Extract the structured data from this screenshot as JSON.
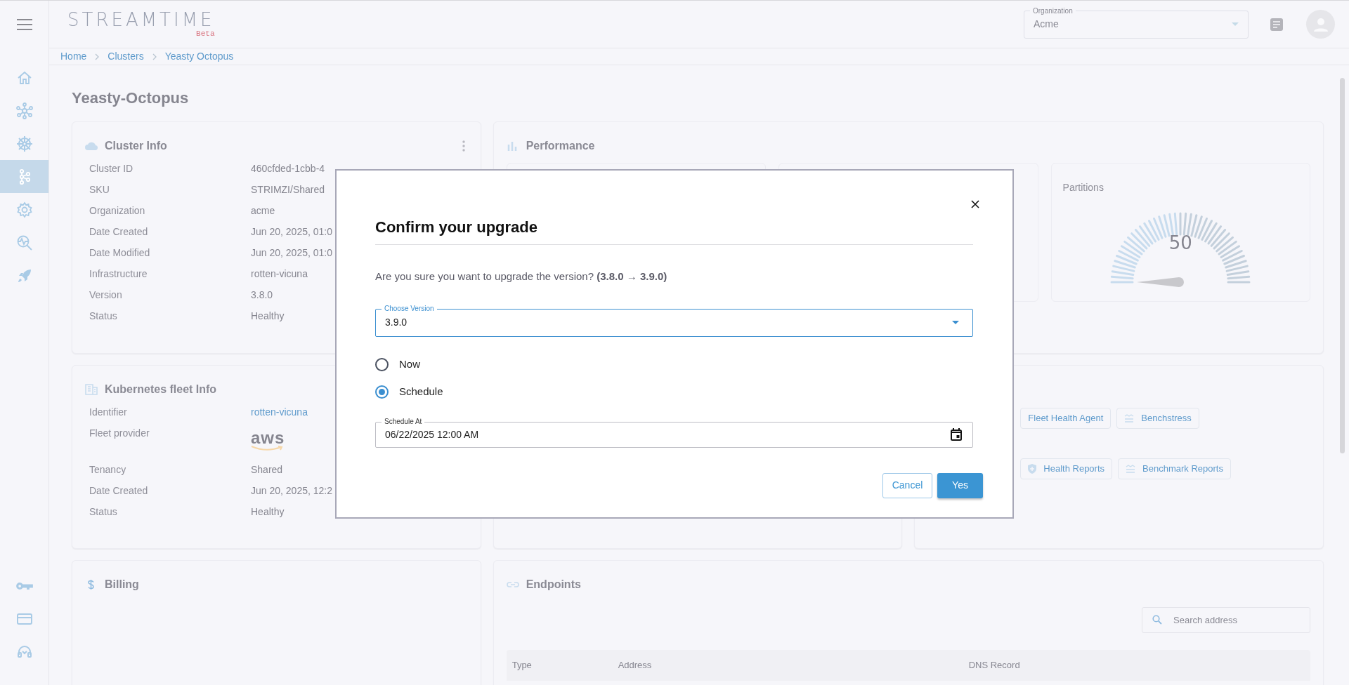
{
  "header": {
    "logo": "STREAMTIME",
    "logo_tag": "Beta",
    "organization": {
      "label": "Organization",
      "value": "Acme"
    }
  },
  "sidebar": {
    "top_items": [
      {
        "kind": "home",
        "selected": false
      },
      {
        "kind": "network",
        "selected": false
      },
      {
        "kind": "wheel",
        "selected": false
      },
      {
        "kind": "nodes",
        "selected": true
      },
      {
        "kind": "gear",
        "selected": false
      },
      {
        "kind": "monitor",
        "selected": false
      },
      {
        "kind": "rocket",
        "selected": false
      }
    ],
    "bottom_items": [
      {
        "kind": "key",
        "selected": false
      },
      {
        "kind": "card",
        "selected": false
      },
      {
        "kind": "headset",
        "selected": false
      }
    ]
  },
  "breadcrumbs": [
    "Home",
    "Clusters",
    "Yeasty Octopus"
  ],
  "page_title": "Yeasty-Octopus",
  "cluster_info": {
    "title": "Cluster Info",
    "rows": [
      {
        "label": "Cluster ID",
        "value": "460cfded-1cbb-4"
      },
      {
        "label": "SKU",
        "value": "STRIMZI/Shared"
      },
      {
        "label": "Organization",
        "value": "acme"
      },
      {
        "label": "Date Created",
        "value": "Jun 20, 2025, 01:0"
      },
      {
        "label": "Date Modified",
        "value": "Jun 20, 2025, 01:0"
      },
      {
        "label": "Infrastructure",
        "value": "rotten-vicuna"
      },
      {
        "label": "Version",
        "value": "3.8.0"
      },
      {
        "label": "Status",
        "value": "Healthy"
      }
    ]
  },
  "performance": {
    "title": "Performance",
    "partitions": {
      "label": "Partitions",
      "reading": "50"
    }
  },
  "fleet_info": {
    "title": "Kubernetes fleet Info",
    "rows": [
      {
        "label": "Identifier",
        "value": "rotten-vicuna",
        "kind": "link"
      },
      {
        "label": "Fleet provider",
        "value": "aws",
        "kind": "logo"
      },
      {
        "label": "Tenancy",
        "value": "Shared",
        "kind": "text"
      },
      {
        "label": "Date Created",
        "value": "Jun 20, 2025, 12:2",
        "kind": "text"
      },
      {
        "label": "Status",
        "value": "Healthy",
        "kind": "text"
      }
    ]
  },
  "tools": {
    "rows": [
      [
        {
          "label": "Fleet Health Agent",
          "kind": "plain"
        },
        {
          "label": "Benchstress",
          "kind": "lines"
        }
      ],
      [
        {
          "label": "Health Reports",
          "kind": "shield"
        },
        {
          "label": "Benchmark Reports",
          "kind": "lines"
        }
      ]
    ]
  },
  "billing": {
    "title": "Billing"
  },
  "endpoints": {
    "title": "Endpoints",
    "search_placeholder": "Search address",
    "columns": [
      "Type",
      "Address",
      "DNS Record"
    ]
  },
  "dialog": {
    "title": "Confirm your upgrade",
    "message": "Are you sure you want to upgrade the version? **(3.8.0 → 3.9.0)**",
    "version_select": {
      "label": "Choose Version",
      "value": "3.9.0"
    },
    "options": [
      {
        "label": "Now",
        "selected": false
      },
      {
        "label": "Schedule",
        "selected": true
      }
    ],
    "schedule_field": {
      "label": "Schedule At",
      "value": "06/22/2025 12:00 AM"
    },
    "buttons": [
      {
        "label": "Cancel",
        "kind": "secondary"
      },
      {
        "label": "Yes",
        "kind": "primary"
      }
    ]
  }
}
